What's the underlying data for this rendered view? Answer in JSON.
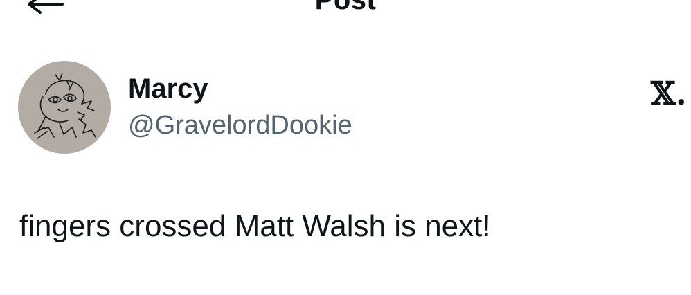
{
  "header": {
    "title": "Post",
    "back_icon": "arrow-left-icon"
  },
  "author": {
    "display_name": "Marcy",
    "handle": "@GravelordDookie",
    "avatar_bg": "#b3aca5"
  },
  "brand": {
    "logo_text": "𝕏.",
    "logo_icon": "x-logo-icon"
  },
  "post": {
    "text": "fingers crossed Matt Walsh is next!"
  },
  "colors": {
    "text_primary": "#0f1419",
    "text_secondary": "#536471",
    "background": "#ffffff"
  }
}
